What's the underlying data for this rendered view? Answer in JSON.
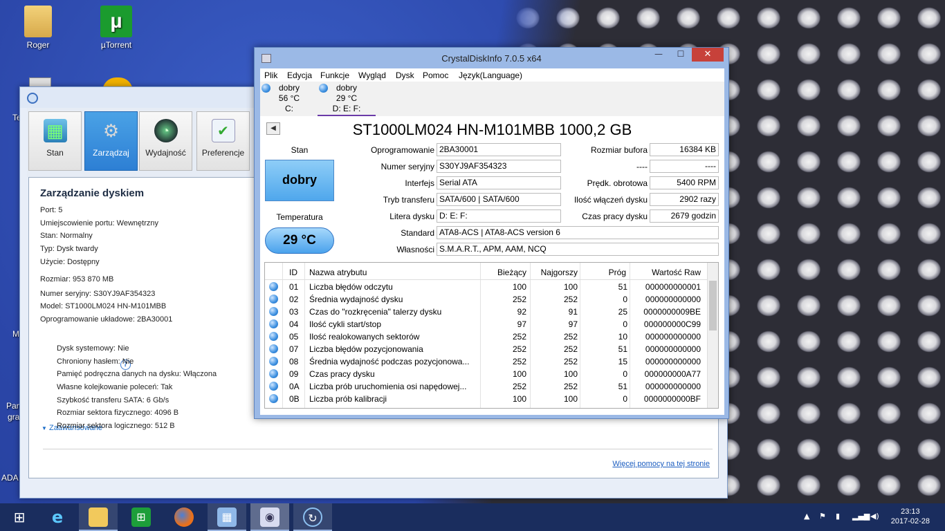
{
  "desktop": {
    "icons": [
      {
        "label": "Roger"
      },
      {
        "label": "µTorrent"
      }
    ],
    "edge_labels": [
      "Te",
      "M",
      "Pan",
      "gra",
      "ADA"
    ]
  },
  "manager": {
    "toolbar": [
      {
        "label": "Stan",
        "active": false
      },
      {
        "label": "Zarządzaj",
        "active": true
      },
      {
        "label": "Wydajność",
        "active": false
      },
      {
        "label": "Preferencje",
        "active": false
      }
    ],
    "title": "Zarządzanie dyskiem",
    "props": [
      "Port: 5",
      "Umiejscowienie portu: Wewnętrzny",
      "Stan: Normalny",
      "Typ: Dysk twardy",
      "Użycie: Dostępny",
      "Rozmiar: 953 870 MB",
      "Numer seryjny: S30YJ9AF354323",
      "Model: ST1000LM024 HN-M101MBB",
      "Oprogramowanie układowe: 2BA30001"
    ],
    "help": "?",
    "advanced_label": "Zaawansowane",
    "advanced": [
      "Dysk systemowy: Nie",
      "Chroniony hasłem: Nie",
      "Pamięć podręczna danych na dysku: Włączona",
      "Własne kolejkowanie poleceń: Tak",
      "Szybkość transferu SATA: 6 Gb/s",
      "Rozmiar sektora fizycznego: 4096 B",
      "Rozmiar sektora logicznego: 512 B"
    ],
    "more_help": "Więcej pomocy na tej stronie"
  },
  "cdi": {
    "title": "CrystalDiskInfo 7.0.5 x64",
    "window_buttons": {
      "minimize": "—",
      "maximize": "☐",
      "close": "✕"
    },
    "menu": [
      "Plik",
      "Edycja",
      "Funkcje",
      "Wygląd",
      "Dysk",
      "Pomoc",
      "Język(Language)"
    ],
    "disks": [
      {
        "status": "dobry",
        "temp": "56 °C",
        "letter": "C:"
      },
      {
        "status": "dobry",
        "temp": "29 °C",
        "letter": "D: E: F:"
      }
    ],
    "model": "ST1000LM024 HN-M101MBB 1000,2 GB",
    "nav_left": "◀",
    "status_label": "Stan",
    "status_value": "dobry",
    "temp_label": "Temperatura",
    "temp_value": "29 °C",
    "fields": {
      "firmware": {
        "label": "Oprogramowanie",
        "value": "2BA30001"
      },
      "serial": {
        "label": "Numer seryjny",
        "value": "S30YJ9AF354323"
      },
      "interface": {
        "label": "Interfejs",
        "value": "Serial ATA"
      },
      "transfer": {
        "label": "Tryb transferu",
        "value": "SATA/600 | SATA/600"
      },
      "letters": {
        "label": "Litera dysku",
        "value": "D: E: F:"
      },
      "standard": {
        "label": "Standard",
        "value": "ATA8-ACS | ATA8-ACS version 6"
      },
      "features": {
        "label": "Własności",
        "value": "S.M.A.R.T., APM, AAM, NCQ"
      },
      "buffer": {
        "label": "Rozmiar bufora",
        "value": "16384 KB"
      },
      "unknown": {
        "label": "----",
        "value": "----"
      },
      "rpm": {
        "label": "Prędk. obrotowa",
        "value": "5400 RPM"
      },
      "power_count": {
        "label": "Ilość włączeń dysku",
        "value": "2902 razy"
      },
      "power_hours": {
        "label": "Czas pracy dysku",
        "value": "2679 godzin"
      }
    },
    "smart": {
      "headers": [
        "ID",
        "Nazwa atrybutu",
        "Bieżący",
        "Najgorszy",
        "Próg",
        "Wartość Raw"
      ],
      "rows": [
        [
          "01",
          "Liczba błędów odczytu",
          "100",
          "100",
          "51",
          "000000000001"
        ],
        [
          "02",
          "Średnia wydajność dysku",
          "252",
          "252",
          "0",
          "000000000000"
        ],
        [
          "03",
          "Czas do \"rozkręcenia\" talerzy dysku",
          "92",
          "91",
          "25",
          "0000000009BE"
        ],
        [
          "04",
          "Ilość cykli start/stop",
          "97",
          "97",
          "0",
          "000000000C99"
        ],
        [
          "05",
          "Ilość realokowanych sektorów",
          "252",
          "252",
          "10",
          "000000000000"
        ],
        [
          "07",
          "Liczba błędów pozycjonowania",
          "252",
          "252",
          "51",
          "000000000000"
        ],
        [
          "08",
          "Średnia wydajność podczas pozycjonowa...",
          "252",
          "252",
          "15",
          "000000000000"
        ],
        [
          "09",
          "Czas pracy dysku",
          "100",
          "100",
          "0",
          "000000000A77"
        ],
        [
          "0A",
          "Liczba prób uruchomienia osi napędowej...",
          "252",
          "252",
          "51",
          "000000000000"
        ],
        [
          "0B",
          "Liczba prób kalibracji",
          "100",
          "100",
          "0",
          "0000000000BF"
        ]
      ]
    }
  },
  "taskbar": {
    "time": "23:13",
    "date": "2017-02-28"
  }
}
